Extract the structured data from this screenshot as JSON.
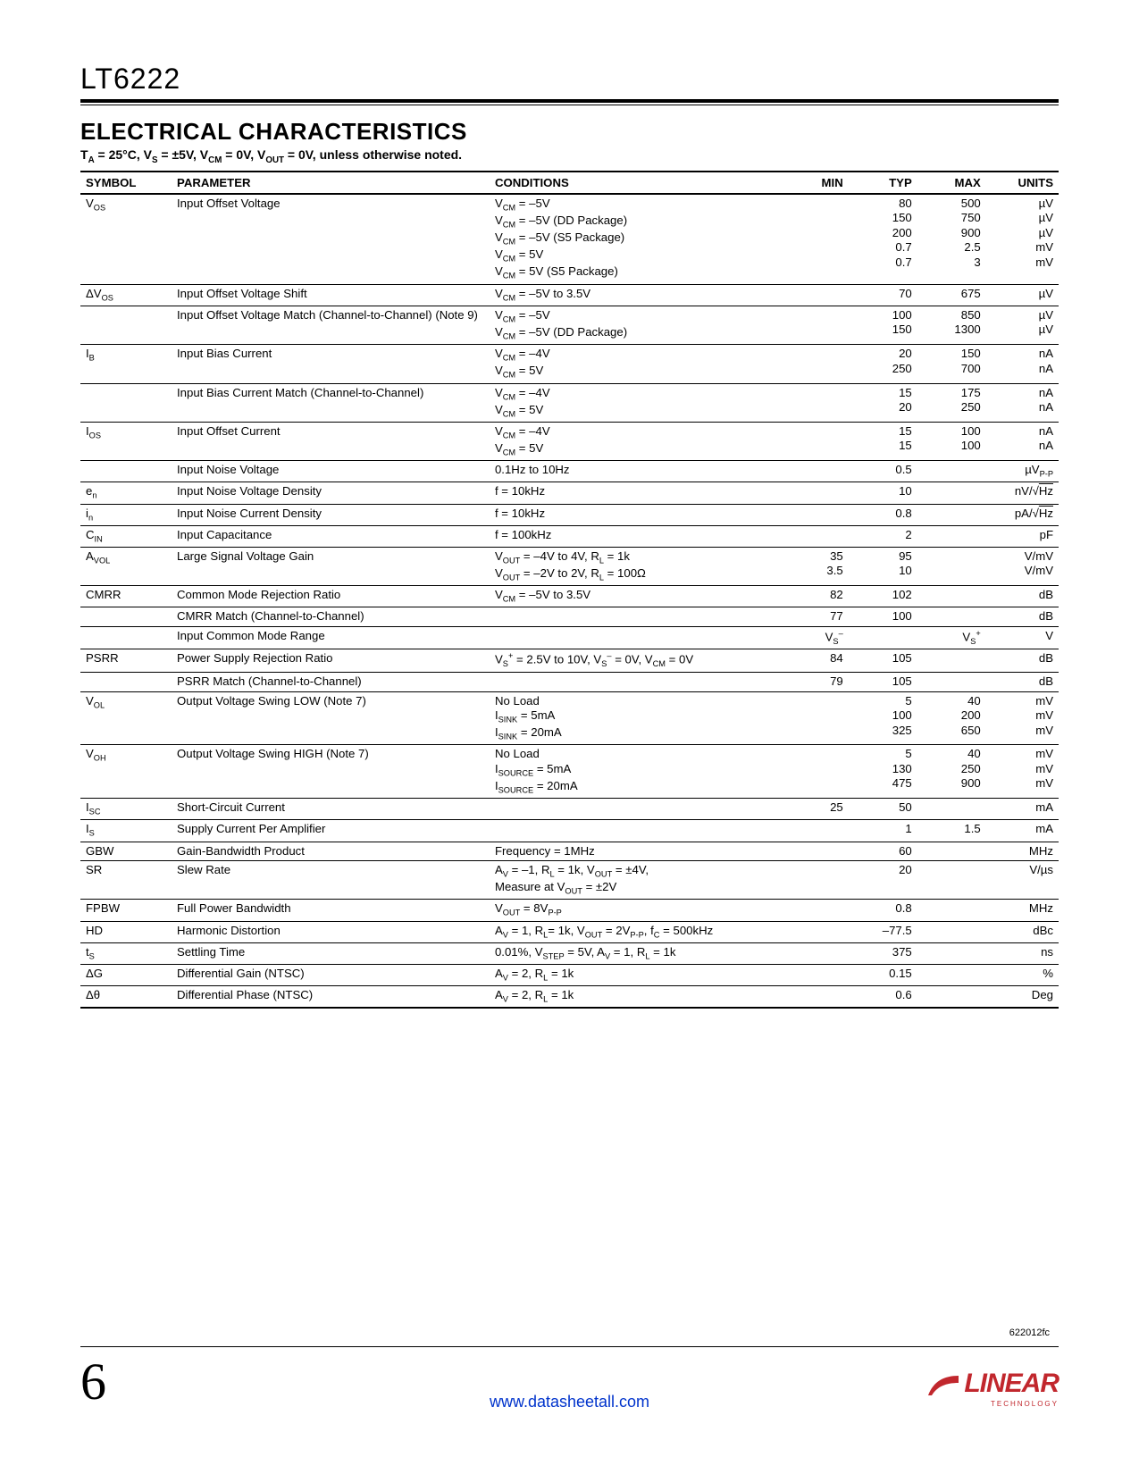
{
  "header": {
    "part_number": "LT6222"
  },
  "section": {
    "title": "ELECTRICAL CHARACTERISTICS",
    "conditions_html": "T<sub>A</sub> = 25°C, V<sub>S</sub> = ±5V, V<sub>CM</sub> = 0V, V<sub>OUT</sub> = 0V, unless otherwise noted."
  },
  "table": {
    "headers": {
      "symbol": "SYMBOL",
      "parameter": "PARAMETER",
      "conditions": "CONDITIONS",
      "min": "MIN",
      "typ": "TYP",
      "max": "MAX",
      "units": "UNITS"
    },
    "rows": [
      {
        "sep": true,
        "symbol_html": "V<sub>OS</sub>",
        "parameter": "Input Offset Voltage",
        "conditions_html": "V<sub>CM</sub> = –5V<br>V<sub>CM</sub> = –5V (DD Package)<br>V<sub>CM</sub> = –5V (S5 Package)<br>V<sub>CM</sub> = 5V<br>V<sub>CM</sub> = 5V (S5 Package)",
        "min": "",
        "typ_html": "80<br>150<br>200<br>0.7<br>0.7",
        "max_html": "500<br>750<br>900<br>2.5<br>3",
        "units_html": "µV<br>µV<br>µV<br>mV<br>mV"
      },
      {
        "sep": true,
        "symbol_html": "ΔV<sub>OS</sub>",
        "parameter": "Input Offset Voltage Shift",
        "conditions_html": "V<sub>CM</sub> = –5V to 3.5V",
        "min": "",
        "typ_html": "70",
        "max_html": "675",
        "units_html": "µV"
      },
      {
        "sep": true,
        "symbol_html": "",
        "parameter": "Input Offset Voltage Match (Channel-to-Channel) (Note 9)",
        "conditions_html": "V<sub>CM</sub> = –5V<br>V<sub>CM</sub> = –5V (DD Package)",
        "min": "",
        "typ_html": "100<br>150",
        "max_html": "850<br>1300",
        "units_html": "µV<br>µV"
      },
      {
        "sep": true,
        "symbol_html": "I<sub>B</sub>",
        "parameter": "Input Bias Current",
        "conditions_html": "V<sub>CM</sub> = –4V<br>V<sub>CM</sub> = 5V",
        "min": "",
        "typ_html": "20<br>250",
        "max_html": "150<br>700",
        "units_html": "nA<br>nA"
      },
      {
        "sep": true,
        "symbol_html": "",
        "parameter": "Input Bias Current Match (Channel-to-Channel)",
        "conditions_html": "V<sub>CM</sub> = –4V<br>V<sub>CM</sub> = 5V",
        "min": "",
        "typ_html": "15<br>20",
        "max_html": "175<br>250",
        "units_html": "nA<br>nA"
      },
      {
        "sep": true,
        "symbol_html": "I<sub>OS</sub>",
        "parameter": "Input Offset Current",
        "conditions_html": "V<sub>CM</sub> = –4V<br>V<sub>CM</sub> = 5V",
        "min": "",
        "typ_html": "15<br>15",
        "max_html": "100<br>100",
        "units_html": "nA<br>nA"
      },
      {
        "sep": true,
        "symbol_html": "",
        "parameter": "Input Noise Voltage",
        "conditions_html": "0.1Hz to 10Hz",
        "min": "",
        "typ_html": "0.5",
        "max_html": "",
        "units_html": "µV<sub>P-P</sub>"
      },
      {
        "sep": true,
        "symbol_html": "e<sub>n</sub>",
        "parameter": "Input Noise Voltage Density",
        "conditions_html": "f = 10kHz",
        "min": "",
        "typ_html": "10",
        "max_html": "",
        "units_html": "nV/√<span style='text-decoration:overline'>Hz</span>"
      },
      {
        "sep": true,
        "symbol_html": "i<sub>n</sub>",
        "parameter": "Input Noise Current Density",
        "conditions_html": "f = 10kHz",
        "min": "",
        "typ_html": "0.8",
        "max_html": "",
        "units_html": "pA/√<span style='text-decoration:overline'>Hz</span>"
      },
      {
        "sep": true,
        "symbol_html": "C<sub>IN</sub>",
        "parameter": "Input Capacitance",
        "conditions_html": "f = 100kHz",
        "min": "",
        "typ_html": "2",
        "max_html": "",
        "units_html": "pF"
      },
      {
        "sep": true,
        "symbol_html": "A<sub>VOL</sub>",
        "parameter": "Large Signal Voltage Gain",
        "conditions_html": "V<sub>OUT</sub> = –4V to 4V, R<sub>L</sub> = 1k<br>V<sub>OUT</sub> = –2V to 2V, R<sub>L</sub> = 100Ω",
        "min_html": "35<br>3.5",
        "typ_html": "95<br>10",
        "max_html": "",
        "units_html": "V/mV<br>V/mV"
      },
      {
        "sep": true,
        "symbol_html": "CMRR",
        "parameter": "Common Mode Rejection Ratio",
        "conditions_html": "V<sub>CM</sub> = –5V to 3.5V",
        "min_html": "82",
        "typ_html": "102",
        "max_html": "",
        "units_html": "dB"
      },
      {
        "sep": true,
        "symbol_html": "",
        "parameter": "CMRR Match (Channel-to-Channel)",
        "conditions_html": "",
        "min_html": "77",
        "typ_html": "100",
        "max_html": "",
        "units_html": "dB"
      },
      {
        "sep": true,
        "symbol_html": "",
        "parameter": "Input Common Mode Range",
        "conditions_html": "",
        "min_html": "V<sub>S</sub><sup>–</sup>",
        "typ_html": "",
        "max_html": "V<sub>S</sub><sup>+</sup>",
        "units_html": "V"
      },
      {
        "sep": true,
        "symbol_html": "PSRR",
        "parameter": "Power Supply Rejection Ratio",
        "conditions_html": "V<sub>S</sub><sup>+</sup> = 2.5V to 10V, V<sub>S</sub><sup>–</sup> = 0V, V<sub>CM</sub> = 0V",
        "min_html": "84",
        "typ_html": "105",
        "max_html": "",
        "units_html": "dB"
      },
      {
        "sep": true,
        "symbol_html": "",
        "parameter": "PSRR Match (Channel-to-Channel)",
        "conditions_html": "",
        "min_html": "79",
        "typ_html": "105",
        "max_html": "",
        "units_html": "dB"
      },
      {
        "sep": true,
        "symbol_html": "V<sub>OL</sub>",
        "parameter": "Output Voltage Swing LOW (Note 7)",
        "conditions_html": "No Load<br>I<sub>SINK</sub> = 5mA<br>I<sub>SINK</sub> = 20mA",
        "min_html": "",
        "typ_html": "5<br>100<br>325",
        "max_html": "40<br>200<br>650",
        "units_html": "mV<br>mV<br>mV"
      },
      {
        "sep": true,
        "symbol_html": "V<sub>OH</sub>",
        "parameter": "Output Voltage Swing HIGH (Note 7)",
        "conditions_html": "No Load<br>I<sub>SOURCE</sub> = 5mA<br>I<sub>SOURCE</sub> = 20mA",
        "min_html": "",
        "typ_html": "5<br>130<br>475",
        "max_html": "40<br>250<br>900",
        "units_html": "mV<br>mV<br>mV"
      },
      {
        "sep": true,
        "symbol_html": "I<sub>SC</sub>",
        "parameter": "Short-Circuit Current",
        "conditions_html": "",
        "min_html": "25",
        "typ_html": "50",
        "max_html": "",
        "units_html": "mA"
      },
      {
        "sep": true,
        "symbol_html": "I<sub>S</sub>",
        "parameter": "Supply Current Per Amplifier",
        "conditions_html": "",
        "min_html": "",
        "typ_html": "1",
        "max_html": "1.5",
        "units_html": "mA"
      },
      {
        "sep": true,
        "symbol_html": "GBW",
        "parameter": "Gain-Bandwidth Product",
        "conditions_html": "Frequency = 1MHz",
        "min_html": "",
        "typ_html": "60",
        "max_html": "",
        "units_html": "MHz"
      },
      {
        "sep": true,
        "symbol_html": "SR",
        "parameter": "Slew Rate",
        "conditions_html": "A<sub>V</sub> = –1, R<sub>L</sub> = 1k, V<sub>OUT</sub> = ±4V,<br>Measure at V<sub>OUT</sub> = ±2V",
        "min_html": "",
        "typ_html": "20",
        "max_html": "",
        "units_html": "V/µs"
      },
      {
        "sep": true,
        "symbol_html": "FPBW",
        "parameter": "Full Power Bandwidth",
        "conditions_html": "V<sub>OUT</sub> = 8V<sub>P-P</sub>",
        "min_html": "",
        "typ_html": "0.8",
        "max_html": "",
        "units_html": "MHz"
      },
      {
        "sep": true,
        "symbol_html": "HD",
        "parameter": "Harmonic Distortion",
        "conditions_html": "A<sub>V</sub> = 1, R<sub>L</sub>= 1k, V<sub>OUT</sub> = 2V<sub>P-P</sub>, f<sub>C</sub> = 500kHz",
        "min_html": "",
        "typ_html": "–77.5",
        "max_html": "",
        "units_html": "dBc"
      },
      {
        "sep": true,
        "symbol_html": "t<sub>S</sub>",
        "parameter": "Settling Time",
        "conditions_html": "0.01%, V<sub>STEP</sub> = 5V, A<sub>V</sub> = 1, R<sub>L</sub> = 1k",
        "min_html": "",
        "typ_html": "375",
        "max_html": "",
        "units_html": "ns"
      },
      {
        "sep": true,
        "symbol_html": "ΔG",
        "parameter": "Differential Gain (NTSC)",
        "conditions_html": "A<sub>V</sub> = 2, R<sub>L</sub> = 1k",
        "min_html": "",
        "typ_html": "0.15",
        "max_html": "",
        "units_html": "%"
      },
      {
        "sep": true,
        "endline": true,
        "symbol_html": "Δθ",
        "parameter": "Differential Phase (NTSC)",
        "conditions_html": "A<sub>V</sub> = 2, R<sub>L</sub> = 1k",
        "min_html": "",
        "typ_html": "0.6",
        "max_html": "",
        "units_html": "Deg"
      }
    ]
  },
  "footer": {
    "doc_code": "622012fc",
    "page_number": "6",
    "url": "www.datasheetall.com",
    "brand": "LINEAR",
    "brand_sub": "TECHNOLOGY"
  }
}
